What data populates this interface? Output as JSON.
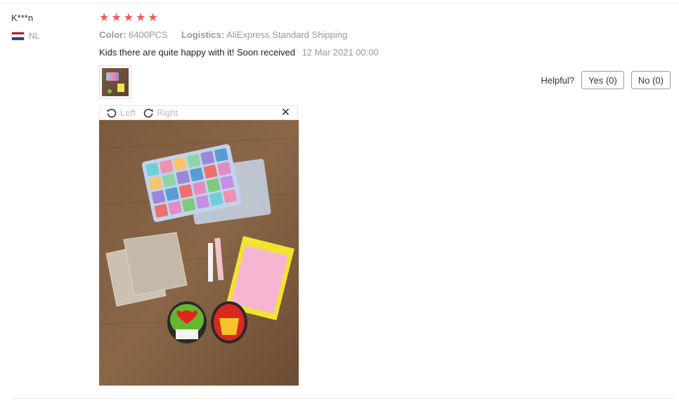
{
  "reviewer": {
    "name": "K***n",
    "country_code": "NL",
    "flag_colors": [
      "#ae1c28",
      "#ffffff",
      "#21468b"
    ]
  },
  "rating": {
    "stars": 5,
    "max": 5,
    "color": "#f0585a"
  },
  "meta": {
    "color_label": "Color:",
    "color_value": "6400PCS",
    "logistics_label": "Logistics:",
    "logistics_value": "AliExpress Standard Shipping"
  },
  "review": {
    "text": "Kids there are quite happy with it! Soon received",
    "date": "12 Mar 2021 00:00"
  },
  "helpful": {
    "label": "Helpful?",
    "yes_label": "Yes (0)",
    "no_label": "No (0)"
  },
  "viewer": {
    "rotate_left_label": "Left",
    "rotate_right_label": "Right",
    "close_glyph": "✕",
    "left_icon": "rotate-left-icon",
    "right_icon": "rotate-right-icon"
  }
}
